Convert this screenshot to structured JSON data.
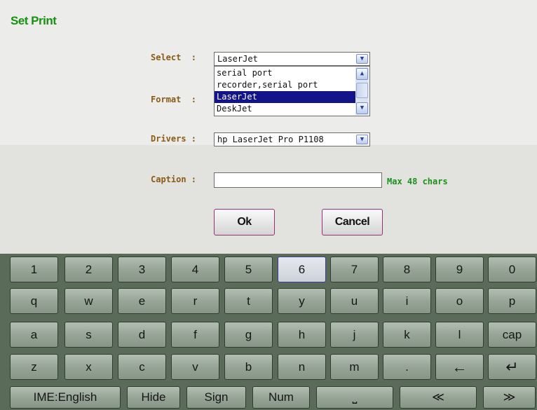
{
  "dialog": {
    "title": "Set Print",
    "select_label": "Select  :",
    "select_value": "LaserJet",
    "select_options": [
      "serial port",
      "recorder,serial port",
      "LaserJet",
      "DeskJet"
    ],
    "selected_option": "LaserJet",
    "format_label": "Format  :",
    "drivers_label": "Drivers :",
    "drivers_value": "hp LaserJet Pro P1108",
    "caption_label": "Caption :",
    "caption_value": "",
    "caption_hint": "Max 48 chars",
    "ok_label": "Ok",
    "cancel_label": "Cancel"
  },
  "keyboard": {
    "row1": [
      "1",
      "2",
      "3",
      "4",
      "5",
      "6",
      "7",
      "8",
      "9",
      "0"
    ],
    "row2": [
      "q",
      "w",
      "e",
      "r",
      "t",
      "y",
      "u",
      "i",
      "o",
      "p"
    ],
    "row3": [
      "a",
      "s",
      "d",
      "f",
      "g",
      "h",
      "j",
      "k",
      "l",
      "cap"
    ],
    "row4": [
      "z",
      "x",
      "c",
      "v",
      "b",
      "n",
      "m",
      "."
    ],
    "backspace_symbol": "←",
    "enter_symbol": "↵",
    "row5": [
      "IME:English",
      "Hide",
      "Sign",
      "Num"
    ],
    "space_symbol": "⎵",
    "prev_symbol": "≪",
    "next_symbol": "≫",
    "highlighted_key": "6",
    "icons": [
      "backspace-icon",
      "enter-icon",
      "space-icon",
      "prev-page-icon",
      "next-page-icon"
    ]
  },
  "colors": {
    "title": "#15920f",
    "label": "#8a5b16",
    "hint": "#1b8f1b",
    "selection": "#14148a",
    "keyboard_bg": "#5a6b5a"
  }
}
